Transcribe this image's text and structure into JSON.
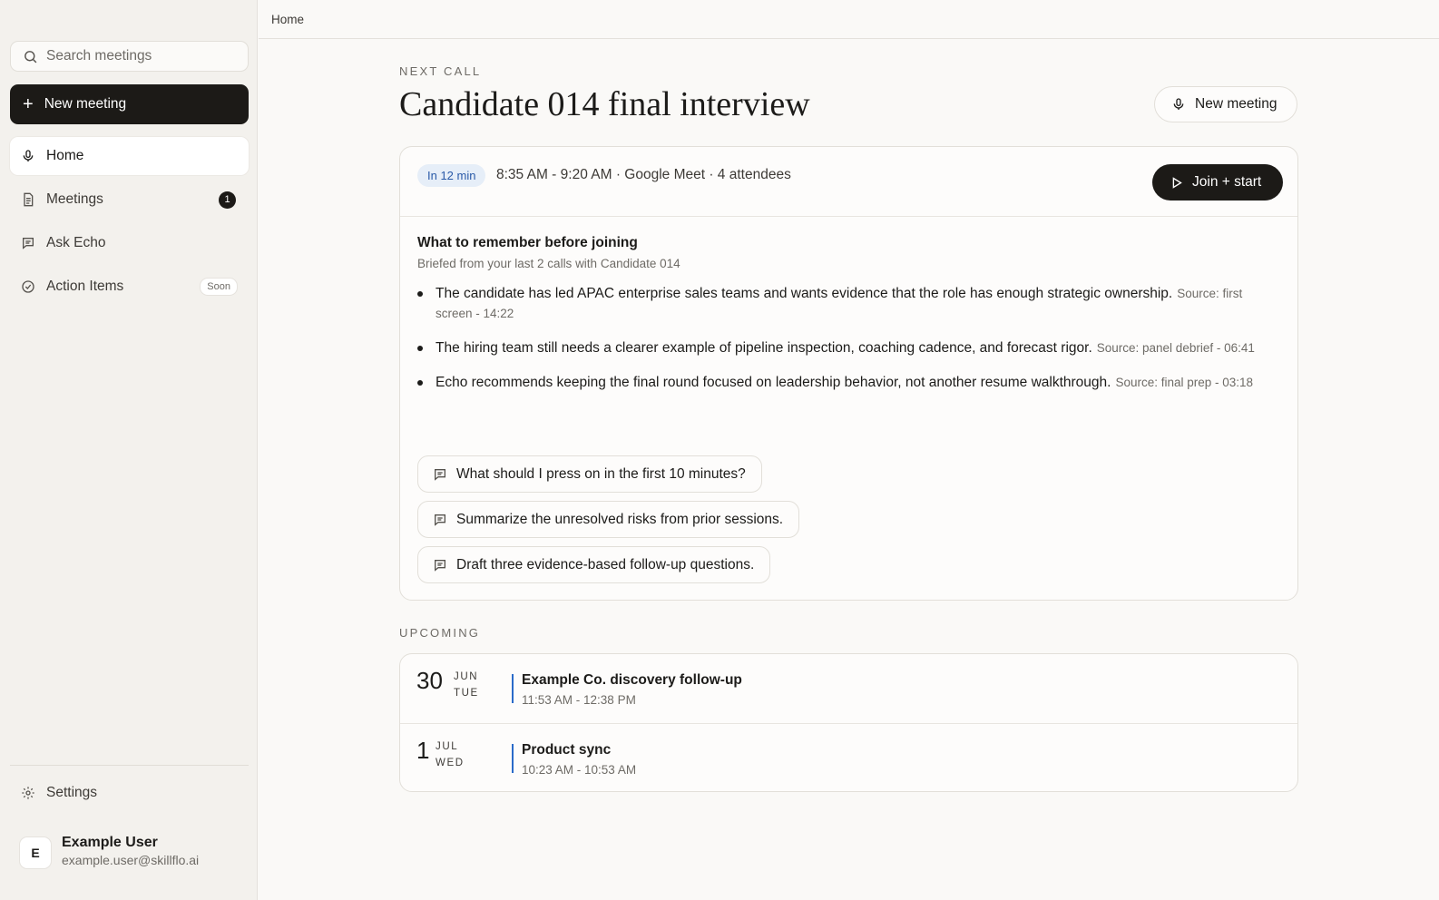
{
  "sidebar": {
    "search_placeholder": "Search meetings",
    "new_meeting_label": "New meeting",
    "items": [
      {
        "label": "Home",
        "icon": "mic-icon",
        "active": true
      },
      {
        "label": "Meetings",
        "icon": "document-icon",
        "badge": "1"
      },
      {
        "label": "Ask Echo",
        "icon": "chat-icon"
      },
      {
        "label": "Action Items",
        "icon": "check-circle-icon",
        "tag": "Soon"
      }
    ],
    "settings_label": "Settings",
    "user": {
      "initial": "E",
      "name": "Example User",
      "email": "example.user@skillflo.ai"
    }
  },
  "topbar": {
    "breadcrumb": "Home"
  },
  "next_call": {
    "eyebrow": "NEXT CALL",
    "title": "Candidate 014 final interview",
    "new_meeting_label": "New meeting",
    "time_pill": "In 12 min",
    "meta": "8:35 AM - 9:20 AM · Google Meet · 4 attendees",
    "join_label": "Join + start",
    "brief_title": "What to remember before joining",
    "brief_subtitle": "Briefed from your last 2 calls with Candidate 014",
    "bullets": [
      {
        "text": "The candidate has led APAC enterprise sales teams and wants evidence that the role has enough strategic ownership.",
        "source": "Source: first screen - 14:22"
      },
      {
        "text": "The hiring team still needs a clearer example of pipeline inspection, coaching cadence, and forecast rigor.",
        "source": "Source: panel debrief - 06:41"
      },
      {
        "text": "Echo recommends keeping the final round focused on leadership behavior, not another resume walkthrough.",
        "source": "Source: final prep - 03:18"
      }
    ],
    "prompts": [
      "What should I press on in the first 10 minutes?",
      "Summarize the unresolved risks from prior sessions.",
      "Draft three evidence-based follow-up questions."
    ]
  },
  "upcoming": {
    "eyebrow": "UPCOMING",
    "items": [
      {
        "day": "30",
        "month": "JUN",
        "weekday": "TUE",
        "title": "Example Co. discovery follow-up",
        "time": "11:53 AM - 12:38 PM"
      },
      {
        "day": "1",
        "month": "JUL",
        "weekday": "WED",
        "title": "Product sync",
        "time": "10:23 AM - 10:53 AM"
      }
    ]
  },
  "colors": {
    "accent": "#2a6bc9",
    "dark_button": "#1c1a17",
    "pill_bg": "#e6eef8",
    "pill_text": "#2a5aa8"
  }
}
